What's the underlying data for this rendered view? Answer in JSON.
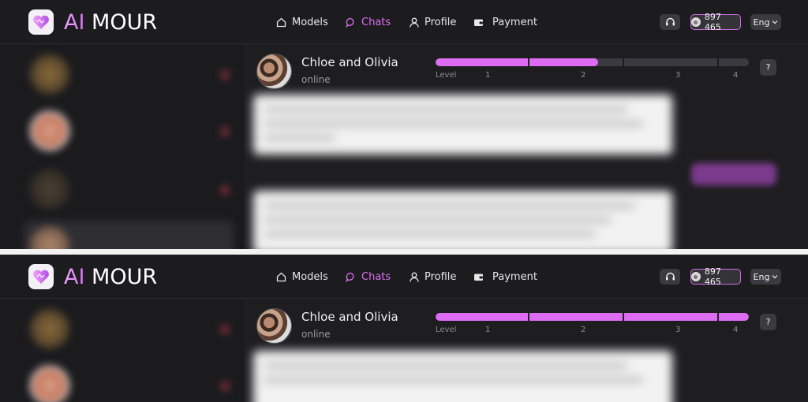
{
  "app": {
    "logo_ai": "AI",
    "logo_mour": "MOUR"
  },
  "nav": {
    "models": "Models",
    "chats": "Chats",
    "profile": "Profile",
    "payment": "Payment"
  },
  "header": {
    "balance": "897 465",
    "language": "Eng"
  },
  "chat": {
    "name": "Chloe and Olivia",
    "status": "online",
    "level_label": "Level",
    "level_ticks": [
      "1",
      "2",
      "3",
      "4"
    ],
    "help": "?"
  },
  "frames": [
    {
      "level_progress_fraction": 0.52
    },
    {
      "level_progress_fraction": 1.0
    }
  ],
  "colors": {
    "accent": "#dd6cf3",
    "background": "#1e1e21",
    "button": "#3a3a3f"
  },
  "icons": [
    "app-logo-heart-icon",
    "home-icon",
    "chat-bubble-icon",
    "user-icon",
    "wallet-icon",
    "headset-icon",
    "coin-icon",
    "chevron-down-icon"
  ]
}
